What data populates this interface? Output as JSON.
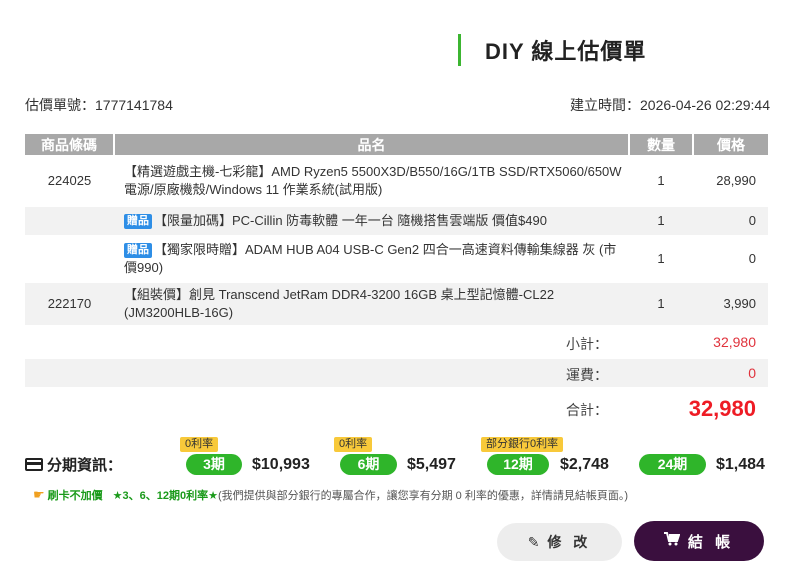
{
  "header": {
    "title": "DIY 線上估價單"
  },
  "meta": {
    "quote_no_label": "估價單號：",
    "quote_no": "1777141784",
    "created_label": "建立時間：",
    "created_at": "2026-04-26 02:29:44"
  },
  "table": {
    "headers": {
      "code": "商品條碼",
      "name": "品名",
      "qty": "數量",
      "price": "價格"
    },
    "rows": [
      {
        "code": "224025",
        "name": "【精選遊戲主機-七彩龍】AMD Ryzen5 5500X3D/B550/16G/1TB SSD/RTX5060/650W電源/原廠機殼/Windows 11 作業系統(試用版)",
        "qty": "1",
        "price": "28,990"
      },
      {
        "code": "",
        "tag": "贈品",
        "name": "【限量加碼】PC-Cillin 防毒軟體 一年一台 隨機搭售雲端版 價值$490",
        "qty": "1",
        "price": "0"
      },
      {
        "code": "",
        "tag": "贈品",
        "name": "【獨家限時贈】ADAM HUB A04 USB-C Gen2 四合一高速資料傳輸集線器 灰 (市價990)",
        "qty": "1",
        "price": "0"
      },
      {
        "code": "222170",
        "name": "【組裝價】創見 Transcend JetRam DDR4-3200 16GB 桌上型記憶體-CL22 (JM3200HLB-16G)",
        "qty": "1",
        "price": "3,990"
      }
    ]
  },
  "summary": {
    "subtotal_label": "小計：",
    "subtotal": "32,980",
    "shipping_label": "運費：",
    "shipping": "0",
    "total_label": "合計：",
    "total": "32,980"
  },
  "installments": {
    "label": "分期資訊：",
    "plans": [
      {
        "tag": "0利率",
        "term": "3期",
        "amount": "$10,993"
      },
      {
        "tag": "0利率",
        "term": "6期",
        "amount": "$5,497"
      },
      {
        "tag": "部分銀行0利率",
        "term": "12期",
        "amount": "$2,748"
      },
      {
        "tag": "",
        "term": "24期",
        "amount": "$1,484"
      }
    ]
  },
  "promo": {
    "icon": "hand-point-icon",
    "strong": "刷卡不加價",
    "green": "★3、6、12期0利率★",
    "note": "(我們提供與部分銀行的專屬合作，讓您享有分期 0 利率的優惠，詳情請見結帳頁面。)"
  },
  "actions": {
    "edit_label": "修 改",
    "checkout_label": "結 帳"
  },
  "colors": {
    "accent_green": "#3cb531",
    "pill_green": "#2fb52a",
    "tag_yellow": "#f8c93a",
    "price_red": "#ee1c25",
    "checkout_bg": "#3a0f3e",
    "gift_blue": "#2e8ee6"
  }
}
